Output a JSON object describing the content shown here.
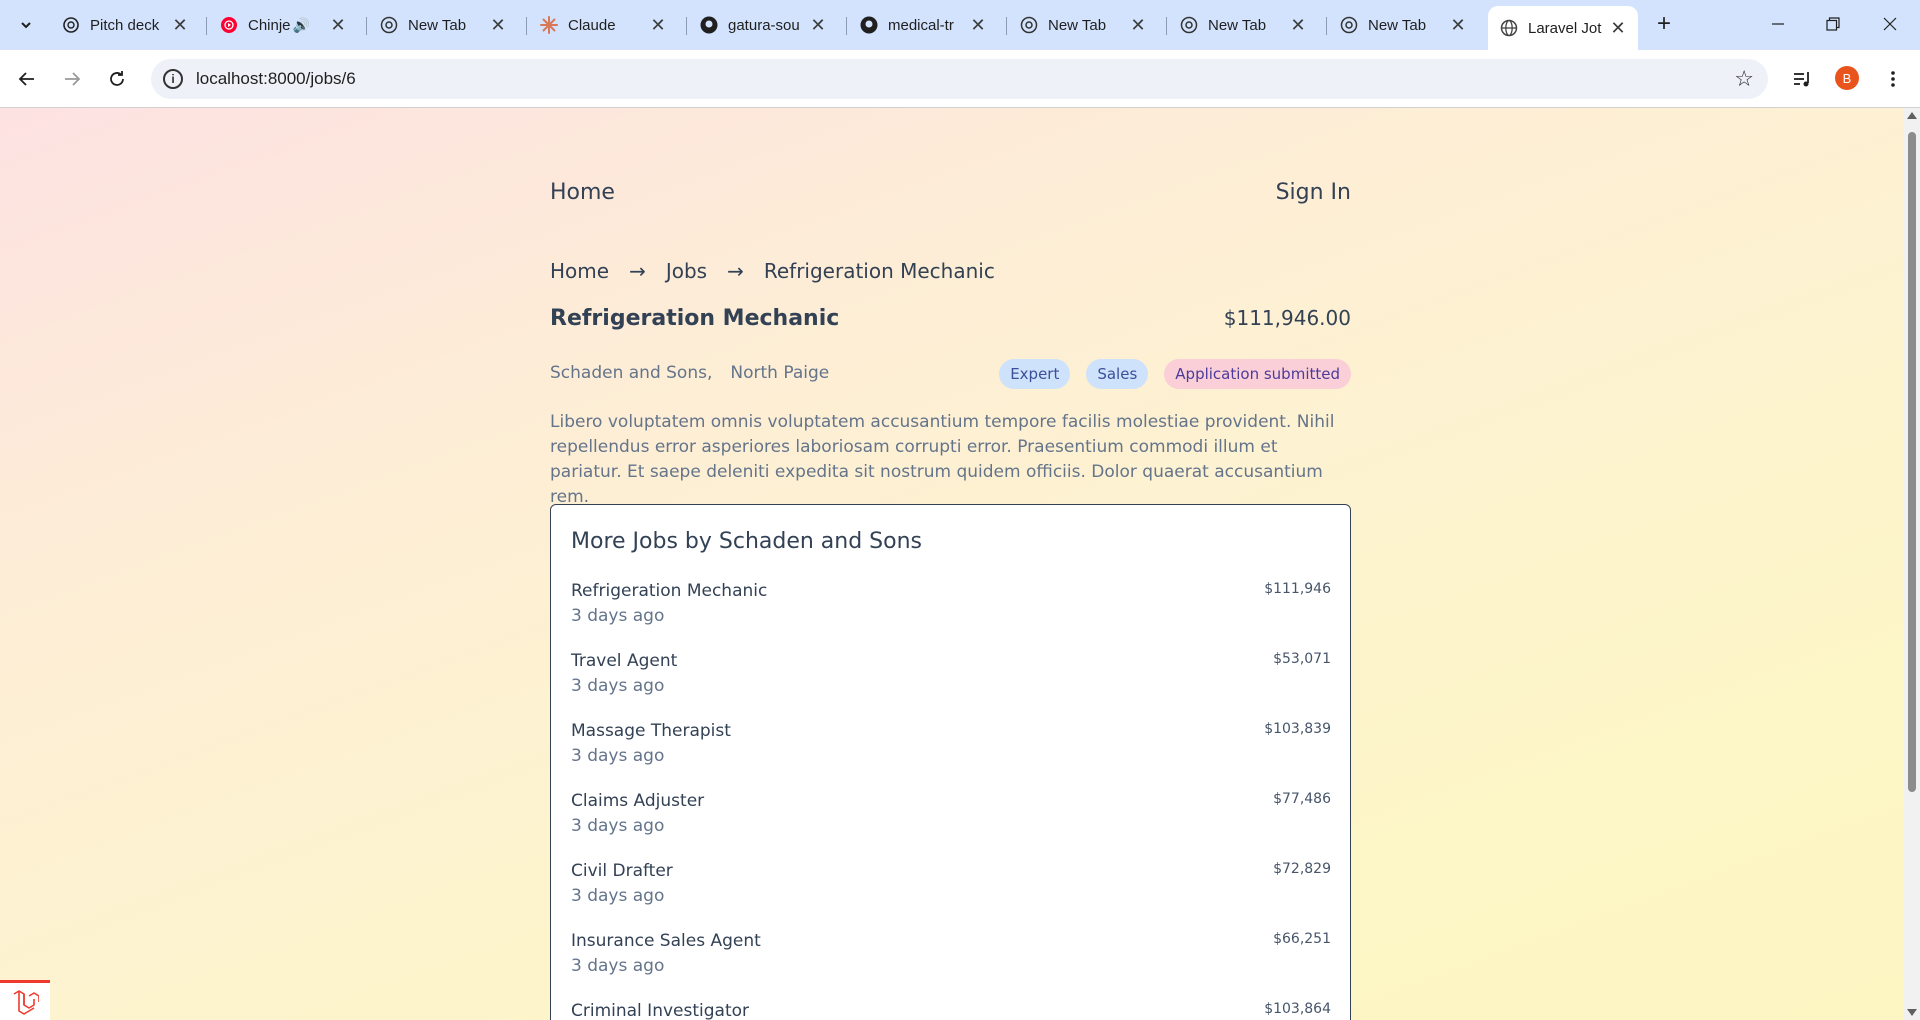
{
  "tabs": [
    {
      "title": "Pitch deck",
      "icon": "openai-icon"
    },
    {
      "title": "Chinje",
      "icon": "youtube-music-icon",
      "audio": "🔊"
    },
    {
      "title": "New Tab",
      "icon": "chrome-icon"
    },
    {
      "title": "Claude",
      "icon": "claude-icon"
    },
    {
      "title": "gatura-sou",
      "icon": "github-icon"
    },
    {
      "title": "medical-tr",
      "icon": "github-icon"
    },
    {
      "title": "New Tab",
      "icon": "chrome-icon"
    },
    {
      "title": "New Tab",
      "icon": "chrome-icon"
    },
    {
      "title": "New Tab",
      "icon": "chrome-icon"
    },
    {
      "title": "Laravel Jot",
      "icon": "globe-icon",
      "active": true
    }
  ],
  "toolbar": {
    "url": "localhost:8000/jobs/6",
    "avatar_letter": "B"
  },
  "nav": {
    "home": "Home",
    "sign_in": "Sign In"
  },
  "breadcrumb": {
    "home": "Home",
    "jobs": "Jobs",
    "current": "Refrigeration Mechanic",
    "separator": "→"
  },
  "job": {
    "title": "Refrigeration Mechanic",
    "salary": "$111,946.00",
    "employer": "Schaden and Sons,",
    "location": "North Paige",
    "tags": [
      "Expert",
      "Sales",
      "Application submitted"
    ],
    "description": "Libero voluptatem omnis voluptatem accusantium tempore facilis molestiae provident. Nihil repellendus error asperiores laboriosam corrupti error. Praesentium commodi illum et pariatur. Et saepe deleniti expedita sit nostrum quidem officiis. Dolor quaerat accusantium rem."
  },
  "more_jobs": {
    "heading": "More Jobs by Schaden and Sons",
    "items": [
      {
        "title": "Refrigeration Mechanic",
        "ago": "3 days ago",
        "salary": "$111,946"
      },
      {
        "title": "Travel Agent",
        "ago": "3 days ago",
        "salary": "$53,071"
      },
      {
        "title": "Massage Therapist",
        "ago": "3 days ago",
        "salary": "$103,839"
      },
      {
        "title": "Claims Adjuster",
        "ago": "3 days ago",
        "salary": "$77,486"
      },
      {
        "title": "Civil Drafter",
        "ago": "3 days ago",
        "salary": "$72,829"
      },
      {
        "title": "Insurance Sales Agent",
        "ago": "3 days ago",
        "salary": "$66,251"
      },
      {
        "title": "Criminal Investigator",
        "ago": "",
        "salary": "$103,864"
      }
    ]
  },
  "colors": {
    "text": "#334155",
    "muted": "#64748b",
    "tag_blue": "#cfe2fb",
    "tag_pink": "#fbcfd8",
    "laravel_red": "#ef3b2d"
  }
}
